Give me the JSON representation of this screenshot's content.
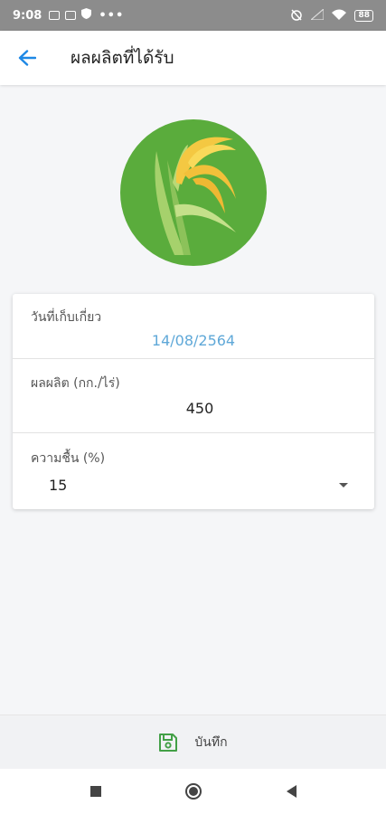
{
  "status_bar": {
    "time": "9:08",
    "battery": "88",
    "left_icons": [
      "message-icon",
      "mail-icon",
      "shield-icon",
      "more-icon"
    ],
    "right_icons": [
      "alarm-icon",
      "signal-icon",
      "wifi-icon",
      "battery-icon"
    ]
  },
  "app_bar": {
    "title": "ผลผลิตที่ได้รับ",
    "back_icon": "arrow-left-icon",
    "accent_color": "#1e88e5"
  },
  "logo": {
    "icon": "rice-plant-icon",
    "background_color": "#5aac3c"
  },
  "form": {
    "harvest_date": {
      "label": "วันที่เก็บเกี่ยว",
      "value": "14/08/2564"
    },
    "yield": {
      "label": "ผลผลิต (กก./ไร่)",
      "value": "450"
    },
    "moisture": {
      "label": "ความชื้น (%)",
      "value": "15"
    }
  },
  "bottom_bar": {
    "save_label": "บันทึก",
    "save_icon": "floppy-disk-icon",
    "save_icon_color": "#43a047"
  },
  "nav_bar": {
    "buttons": [
      "recents-square-icon",
      "home-circle-icon",
      "back-triangle-icon"
    ]
  }
}
